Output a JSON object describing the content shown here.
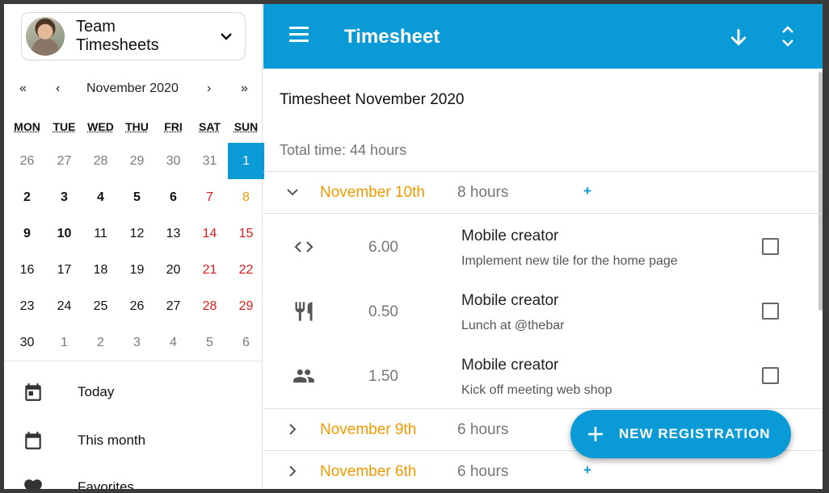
{
  "sidebar": {
    "team_name": "Team Timesheets",
    "calendar": {
      "nav_first": "«",
      "nav_prev": "‹",
      "month_label": "November 2020",
      "nav_next": "›",
      "nav_last": "»",
      "weekdays": [
        "MON",
        "TUE",
        "WED",
        "THU",
        "FRI",
        "SAT",
        "SUN"
      ],
      "weeks": [
        [
          {
            "d": "26",
            "s": "other"
          },
          {
            "d": "27",
            "s": "other"
          },
          {
            "d": "28",
            "s": "other"
          },
          {
            "d": "29",
            "s": "other"
          },
          {
            "d": "30",
            "s": "other"
          },
          {
            "d": "31",
            "s": "other"
          },
          {
            "d": "1",
            "s": "selected"
          }
        ],
        [
          {
            "d": "2",
            "s": "bold"
          },
          {
            "d": "3",
            "s": "bold"
          },
          {
            "d": "4",
            "s": "bold"
          },
          {
            "d": "5",
            "s": "bold"
          },
          {
            "d": "6",
            "s": "bold"
          },
          {
            "d": "7",
            "s": "red"
          },
          {
            "d": "8",
            "s": "orange"
          }
        ],
        [
          {
            "d": "9",
            "s": "bold"
          },
          {
            "d": "10",
            "s": "bold"
          },
          {
            "d": "11",
            "s": ""
          },
          {
            "d": "12",
            "s": ""
          },
          {
            "d": "13",
            "s": ""
          },
          {
            "d": "14",
            "s": "red"
          },
          {
            "d": "15",
            "s": "red"
          }
        ],
        [
          {
            "d": "16",
            "s": ""
          },
          {
            "d": "17",
            "s": ""
          },
          {
            "d": "18",
            "s": ""
          },
          {
            "d": "19",
            "s": ""
          },
          {
            "d": "20",
            "s": ""
          },
          {
            "d": "21",
            "s": "red"
          },
          {
            "d": "22",
            "s": "red"
          }
        ],
        [
          {
            "d": "23",
            "s": ""
          },
          {
            "d": "24",
            "s": ""
          },
          {
            "d": "25",
            "s": ""
          },
          {
            "d": "26",
            "s": ""
          },
          {
            "d": "27",
            "s": ""
          },
          {
            "d": "28",
            "s": "red"
          },
          {
            "d": "29",
            "s": "red"
          }
        ],
        [
          {
            "d": "30",
            "s": ""
          },
          {
            "d": "1",
            "s": "other"
          },
          {
            "d": "2",
            "s": "other"
          },
          {
            "d": "3",
            "s": "other"
          },
          {
            "d": "4",
            "s": "other"
          },
          {
            "d": "5",
            "s": "other"
          },
          {
            "d": "6",
            "s": "other"
          }
        ]
      ]
    },
    "items": [
      {
        "label": "Today",
        "icon": "calendar-today-icon"
      },
      {
        "label": "This month",
        "icon": "calendar-month-icon"
      },
      {
        "label": "Favorites",
        "icon": "heart-icon"
      }
    ]
  },
  "topbar": {
    "title": "Timesheet",
    "sort_icon": "arrow-down-icon",
    "expand_icon": "unfold-icon"
  },
  "main": {
    "sheet_title": "Timesheet November 2020",
    "total_time": "Total time: 44 hours",
    "days": [
      {
        "label": "November 10th",
        "hours": "8 hours",
        "add": "+",
        "expanded": true,
        "entries": [
          {
            "icon": "code-icon",
            "hours": "6.00",
            "project": "Mobile creator",
            "description": "Implement new tile for the home page"
          },
          {
            "icon": "restaurant-icon",
            "hours": "0.50",
            "project": "Mobile creator",
            "description": "Lunch at @thebar"
          },
          {
            "icon": "people-icon",
            "hours": "1.50",
            "project": "Mobile creator",
            "description": "Kick off meeting web shop"
          }
        ]
      },
      {
        "label": "November 9th",
        "hours": "6 hours",
        "add": "+",
        "expanded": false
      },
      {
        "label": "November 6th",
        "hours": "6 hours",
        "add": "+",
        "expanded": false
      }
    ],
    "fab_label": "NEW REGISTRATION"
  },
  "colors": {
    "primary": "#0a9ad6",
    "accent_orange": "#f29900",
    "weekend_red": "#d91c1c"
  }
}
